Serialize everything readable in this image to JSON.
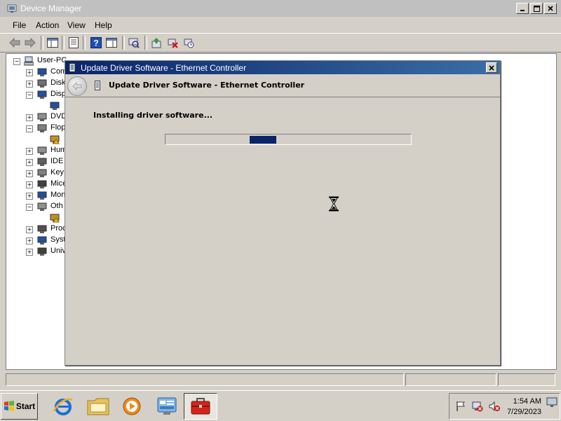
{
  "window": {
    "title": "Device Manager",
    "menu": [
      "File",
      "Action",
      "View",
      "Help"
    ]
  },
  "tree": {
    "root": "User-PC",
    "items": [
      {
        "label": "Com",
        "expander": "+"
      },
      {
        "label": "Disk",
        "expander": "+"
      },
      {
        "label": "Disp",
        "expander": "-"
      },
      {
        "label": "",
        "expander": ""
      },
      {
        "label": "DVD",
        "expander": "+"
      },
      {
        "label": "Flop",
        "expander": "-"
      },
      {
        "label": "",
        "expander": ""
      },
      {
        "label": "Hum",
        "expander": "+"
      },
      {
        "label": "IDE",
        "expander": "+"
      },
      {
        "label": "Key",
        "expander": "+"
      },
      {
        "label": "Mice",
        "expander": "+"
      },
      {
        "label": "Mon",
        "expander": "+"
      },
      {
        "label": "Oth",
        "expander": "-"
      },
      {
        "label": "",
        "expander": ""
      },
      {
        "label": "Proc",
        "expander": "+"
      },
      {
        "label": "Syst",
        "expander": "+"
      },
      {
        "label": "Univ",
        "expander": "+"
      }
    ]
  },
  "dialog": {
    "title": "Update Driver Software - Ethernet Controller",
    "header_title": "Update Driver Software - Ethernet Controller",
    "status": "Installing driver software...",
    "progress_state": "indeterminate"
  },
  "taskbar": {
    "start_label": "Start",
    "clock_time": "1:54 AM",
    "clock_date": "7/29/2023"
  }
}
